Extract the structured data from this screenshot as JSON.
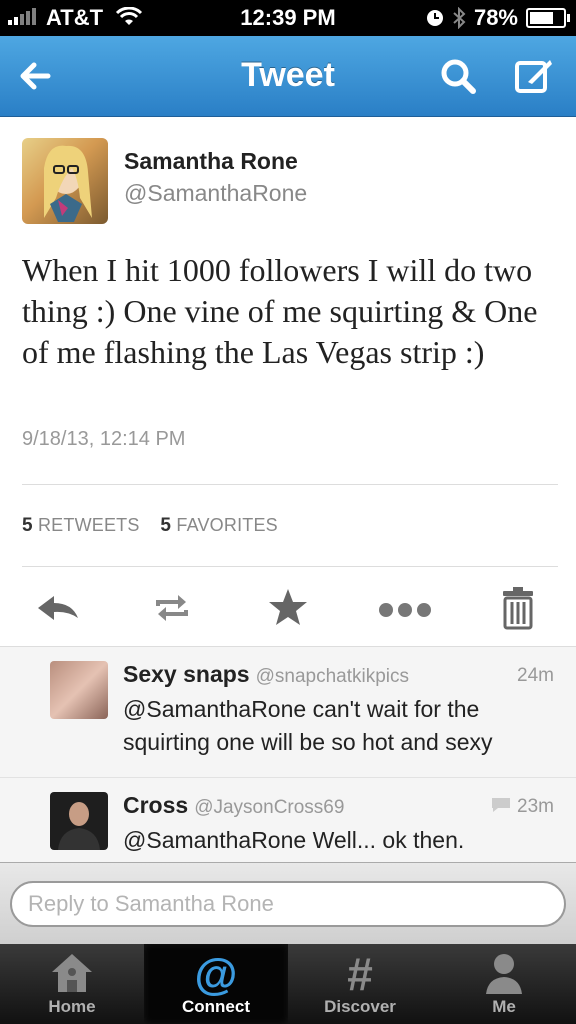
{
  "status_bar": {
    "carrier": "AT&T",
    "time": "12:39 PM",
    "battery": "78%",
    "battery_level": 0.78
  },
  "nav": {
    "title": "Tweet"
  },
  "tweet": {
    "name": "Samantha Rone",
    "handle": "@SamanthaRone",
    "text": "When I hit 1000 followers I will do two thing :) One vine of me squirting & One of me flashing the Las Vegas strip :)",
    "timestamp": "9/18/13, 12:14 PM",
    "retweets_count": "5",
    "retweets_label": "RETWEETS",
    "favorites_count": "5",
    "favorites_label": "FAVORITES"
  },
  "actions": [
    "reply-icon",
    "retweet-icon",
    "favorite-star-icon",
    "more-dots-icon",
    "delete-trash-icon"
  ],
  "replies": [
    {
      "name": "Sexy snaps",
      "handle": "@snapchatkikpics",
      "time": "24m",
      "text": "@SamanthaRone can't wait for the squirting one will be so hot and sexy"
    },
    {
      "name": "Cross",
      "handle": "@JaysonCross69",
      "time": "23m",
      "text": "@SamanthaRone  Well... ok then."
    }
  ],
  "reply_input": {
    "placeholder": "Reply to Samantha Rone"
  },
  "tabs": [
    {
      "label": "Home",
      "icon": "home-icon"
    },
    {
      "label": "Connect",
      "icon": "at-icon"
    },
    {
      "label": "Discover",
      "icon": "hashtag-icon"
    },
    {
      "label": "Me",
      "icon": "person-icon"
    }
  ],
  "colors": {
    "nav_blue": "#2a7fc6",
    "text_gray": "#888888"
  }
}
